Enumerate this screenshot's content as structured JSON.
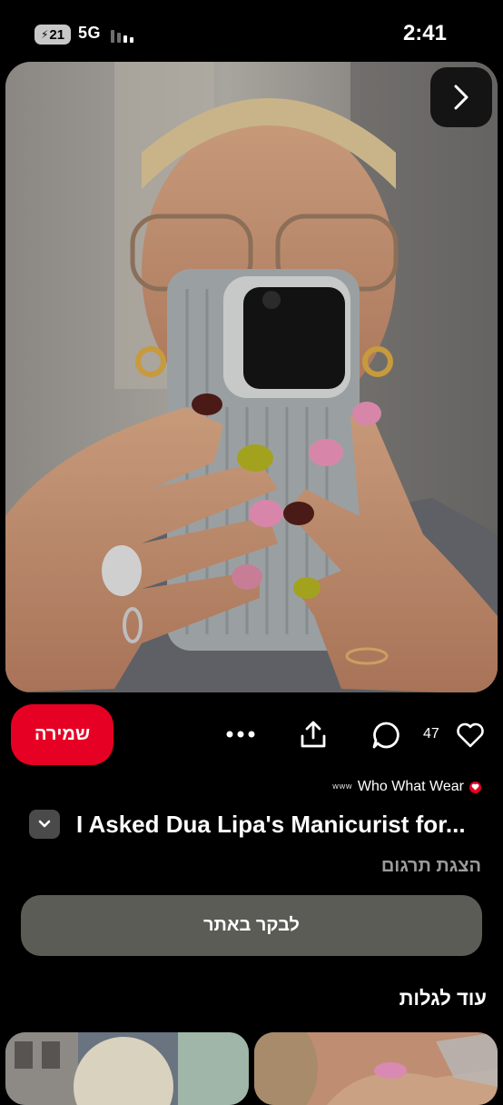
{
  "status_bar": {
    "battery_level": "21",
    "network": "5G",
    "time": "2:41"
  },
  "pin": {
    "next_icon": "chevron-right-icon",
    "save_label": "שמירה",
    "reaction_count": "47",
    "source_name": "Who What Wear",
    "source_mark": "www",
    "title": "I Asked Dua Lipa's Manicurist for...",
    "translate_label": "הצגת תרגום",
    "visit_label": "לבקר באתר"
  },
  "more": {
    "heading": "עוד לגלות"
  },
  "colors": {
    "accent": "#e60023",
    "background": "#000000",
    "visit_button": "#5b5c55",
    "secondary_text": "#9b9b9b"
  }
}
